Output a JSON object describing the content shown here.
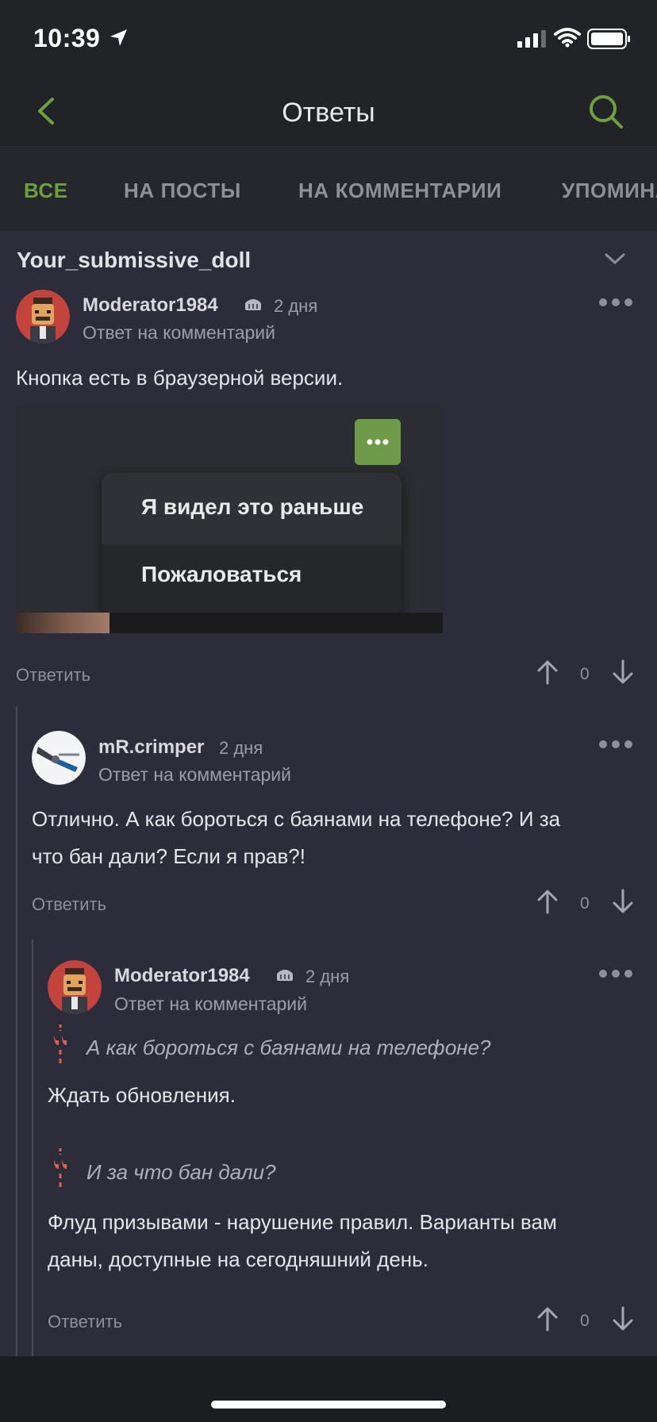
{
  "status_bar": {
    "time": "10:39"
  },
  "nav": {
    "title": "Ответы"
  },
  "tabs": [
    {
      "label": "ВСЕ",
      "active": true
    },
    {
      "label": "НА ПОСТЫ",
      "active": false
    },
    {
      "label": "НА КОММЕНТАРИИ",
      "active": false
    },
    {
      "label": "УПОМИНАНИЯ",
      "active": false
    }
  ],
  "post": {
    "title": "Your_submissive_doll"
  },
  "comments": [
    {
      "username": "Moderator1984",
      "date": "2 дня",
      "subline": "Ответ на комментарий",
      "text": "Кнопка есть в браузерной версии.",
      "image_menu": {
        "item1": "Я видел это раньше",
        "item2": "Пожаловаться"
      },
      "reply_label": "Ответить",
      "votes": "0"
    },
    {
      "username": "mR.crimper",
      "date": "2 дня",
      "subline": "Ответ на комментарий",
      "text_line1": "Отлично. А как бороться с баянами на телефоне? И за",
      "text_line2": "что бан дали? Если я прав?!",
      "reply_label": "Ответить",
      "votes": "0"
    },
    {
      "username": "Moderator1984",
      "date": "2 дня",
      "subline": "Ответ на комментарий",
      "quote1": "А как бороться с баянами на телефоне?",
      "answer1": "Ждать обновления.",
      "quote2": "И за что бан дали?",
      "answer2_line1": "Флуд призывами - нарушение правил. Варианты вам",
      "answer2_line2": "даны, доступные на сегодняшний день.",
      "reply_label": "Ответить",
      "votes": "0"
    }
  ],
  "colors": {
    "accent": "#6ea13d",
    "quote": "#e0604a",
    "background": "#2d2c3b",
    "header": "#212327"
  }
}
